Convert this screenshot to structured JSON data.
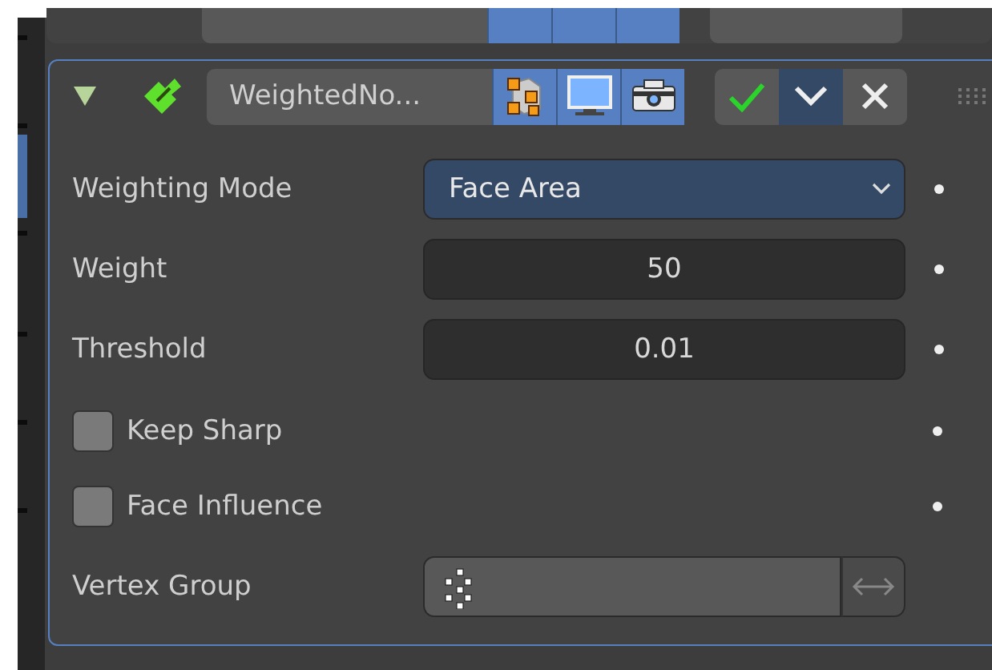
{
  "previous_modifier": {
    "toggles": [
      {
        "on": true
      },
      {
        "on": true
      },
      {
        "on": true
      }
    ]
  },
  "modifier": {
    "expanded": true,
    "name": "WeightedNo...",
    "toggles": [
      {
        "kind": "edit",
        "on": true
      },
      {
        "kind": "viewport",
        "on": true
      },
      {
        "kind": "render",
        "on": true
      }
    ]
  },
  "properties": [
    {
      "kind": "dropdown",
      "label": "Weighting Mode",
      "value": "Face Area"
    },
    {
      "kind": "number",
      "label": "Weight",
      "value": "50"
    },
    {
      "kind": "number",
      "label": "Threshold",
      "value": "0.01"
    },
    {
      "kind": "checkbox",
      "label": "Keep Sharp",
      "checked": false
    },
    {
      "kind": "checkbox",
      "label": "Face Influence",
      "checked": false
    },
    {
      "kind": "group",
      "label": "Vertex Group"
    }
  ]
}
